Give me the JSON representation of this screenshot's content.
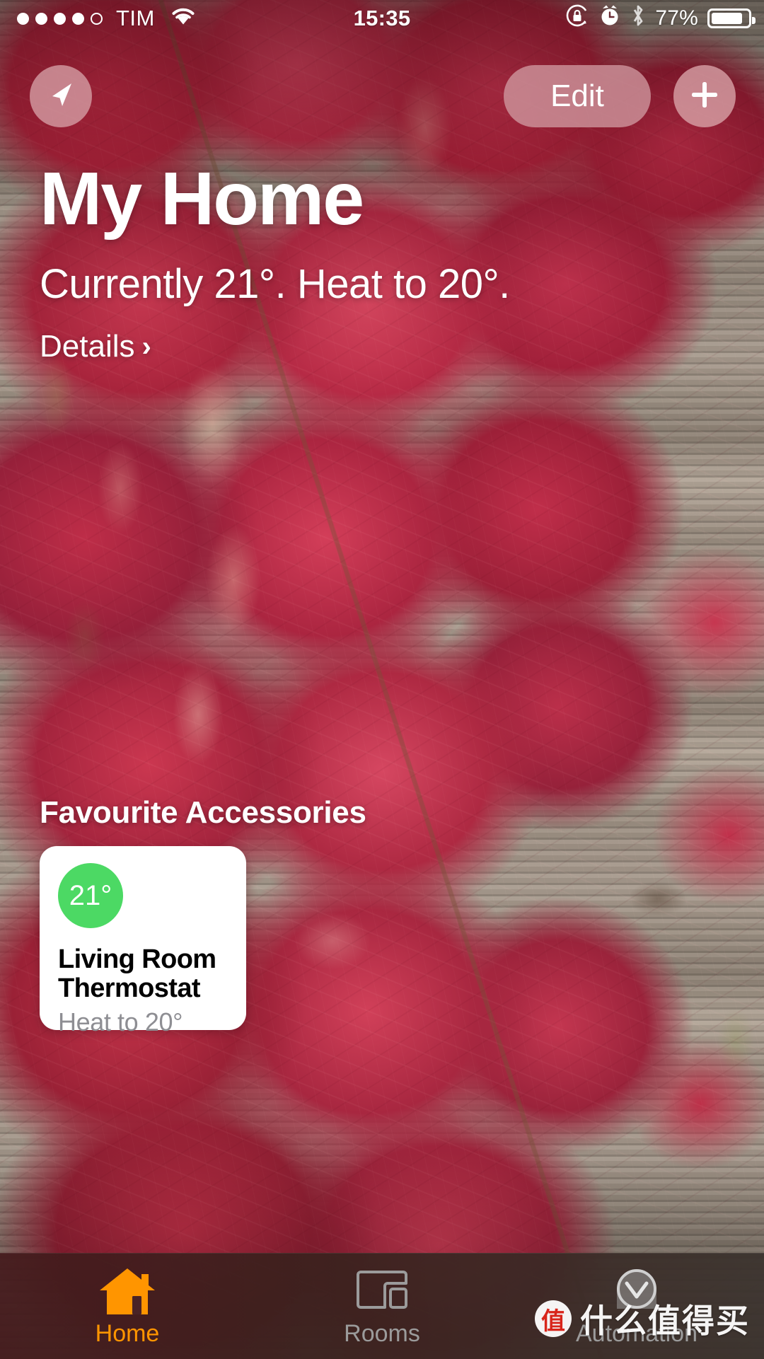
{
  "status_bar": {
    "carrier": "TIM",
    "signal_dots_filled": 4,
    "signal_dots_total": 5,
    "wifi_icon": "wifi-icon",
    "time": "15:35",
    "rotation_lock_icon": "rotation-lock-icon",
    "alarm_icon": "alarm-clock-icon",
    "bluetooth_icon": "bluetooth-icon",
    "battery_percent_label": "77%",
    "battery_level": 77
  },
  "nav": {
    "location_icon": "location-arrow-icon",
    "edit_label": "Edit",
    "add_icon": "plus-icon"
  },
  "home": {
    "title": "My Home",
    "status_line": "Currently 21°. Heat to 20°.",
    "details_label": "Details",
    "details_chevron": "›",
    "current_temperature": "21°",
    "target_temperature": "20°"
  },
  "favourites": {
    "section_title": "Favourite Accessories",
    "accessories": [
      {
        "badge_value": "21°",
        "badge_color": "#4CD964",
        "name": "Living Room Thermostat",
        "state": "Heat to 20°"
      }
    ]
  },
  "tabs": [
    {
      "label": "Home",
      "icon": "house-icon",
      "active": true,
      "color": "#FF9500"
    },
    {
      "label": "Rooms",
      "icon": "rooms-icon",
      "active": false,
      "color": "#9b9b9b"
    },
    {
      "label": "Automation",
      "icon": "automation-clock-icon",
      "active": false,
      "color": "#9b9b9b"
    }
  ],
  "watermark": {
    "logo_char": "值",
    "text": "什么值得买"
  },
  "colors": {
    "accent_orange": "#FF9500",
    "badge_green": "#4CD964",
    "card_white": "#FFFFFF",
    "secondary_text": "#8E8E93"
  }
}
